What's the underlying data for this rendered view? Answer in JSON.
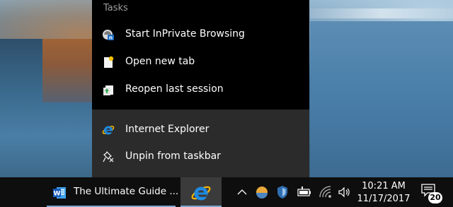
{
  "jumplist": {
    "section_title": "Tasks",
    "tasks": [
      {
        "label": "Start InPrivate Browsing",
        "icon": "inprivate-icon"
      },
      {
        "label": "Open new tab",
        "icon": "new-tab-icon"
      },
      {
        "label": "Reopen last session",
        "icon": "reopen-session-icon"
      }
    ],
    "pinned": [
      {
        "label": "Internet Explorer",
        "icon": "internet-explorer-icon"
      },
      {
        "label": "Unpin from taskbar",
        "icon": "unpin-icon"
      }
    ]
  },
  "taskbar": {
    "word_window_title": "The Ultimate Guide ...",
    "word_icon": "word-icon",
    "ie_icon": "internet-explorer-icon",
    "tray": {
      "icons": [
        "chevron-up-icon",
        "weather-icon",
        "defender-shield-icon",
        "battery-icon",
        "wifi-icon",
        "volume-icon"
      ]
    },
    "clock": {
      "time": "10:21 AM",
      "date": "11/17/2017"
    },
    "notifications": {
      "icon": "action-center-icon",
      "count": "20"
    },
    "accent_color": "#7aa7d7"
  }
}
